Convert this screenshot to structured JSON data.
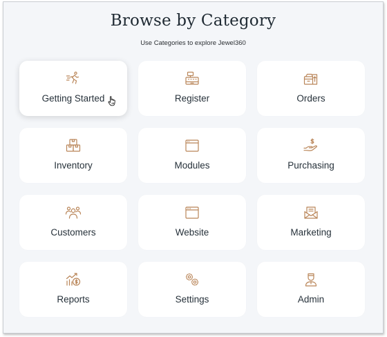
{
  "header": {
    "title": "Browse by Category",
    "subtitle": "Use Categories to explore Jewel360"
  },
  "theme": {
    "accent": "#b98558",
    "background": "#f4f6f9",
    "card": "#ffffff",
    "text": "#26313a"
  },
  "categories": [
    {
      "label": "Getting Started",
      "icon": "running-person-icon"
    },
    {
      "label": "Register",
      "icon": "cash-register-icon"
    },
    {
      "label": "Orders",
      "icon": "boxes-icon"
    },
    {
      "label": "Inventory",
      "icon": "stacked-boxes-icon"
    },
    {
      "label": "Modules",
      "icon": "window-icon"
    },
    {
      "label": "Purchasing",
      "icon": "hand-dollar-icon"
    },
    {
      "label": "Customers",
      "icon": "people-icon"
    },
    {
      "label": "Website",
      "icon": "browser-icon"
    },
    {
      "label": "Marketing",
      "icon": "mail-icon"
    },
    {
      "label": "Reports",
      "icon": "chart-dollar-icon"
    },
    {
      "label": "Settings",
      "icon": "gears-icon"
    },
    {
      "label": "Admin",
      "icon": "admin-person-icon"
    }
  ]
}
